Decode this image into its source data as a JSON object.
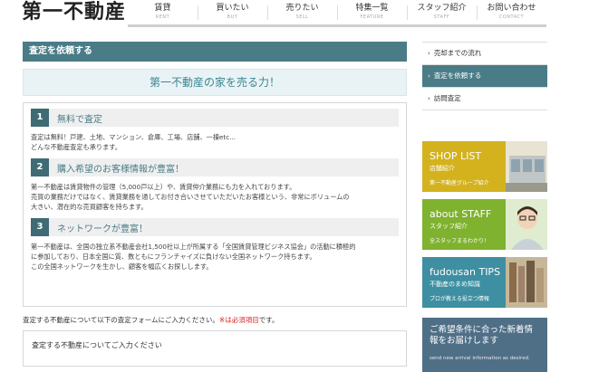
{
  "header": {
    "logo": "第一不動産",
    "nav": [
      {
        "jp": "賃貸",
        "en": "RENT"
      },
      {
        "jp": "買いたい",
        "en": "BUY"
      },
      {
        "jp": "売りたい",
        "en": "SELL"
      },
      {
        "jp": "特集一覧",
        "en": "FEATURE"
      },
      {
        "jp": "スタッフ紹介",
        "en": "STAFF"
      },
      {
        "jp": "お問い合わせ",
        "en": "CONTACT"
      }
    ]
  },
  "main": {
    "title": "査定を依頼する",
    "hero": "第一不動産の家を売る力！",
    "sections": [
      {
        "num": "1",
        "title": "無料で査定",
        "body": "査定は無料！戸建、土地、マンション、倉庫、工場、店舗、一棟etc...\nどんな不動産査定も承ります。"
      },
      {
        "num": "2",
        "title": "購入希望のお客様情報が豊富！",
        "body": "第一不動産は賃貸物件の管理（5,000戸以上）や、賃貸仲介業務にも力を入れております。\n売買の業務だけではなく、賃貸業務を通してお付き合いさせていただいたお客様という、非常にボリュームの\n大きい、潜在的な売買顧客を持ちます。"
      },
      {
        "num": "3",
        "title": "ネットワークが豊富！",
        "body": "第一不動産は、全国の独立系不動産会社1,500社以上が所属する「全国賃貸管理ビジネス協会」の活動に積極的\nに参加しており、日本全国に質、数ともにフランチャイズに負けない全国ネットワーク持ちます。\nこの全国ネットワークを生かし、顧客を幅広くお探しします。"
      }
    ],
    "note": "査定する不動産について以下の査定フォームにご入力ください。",
    "note_required": "※は必須項目",
    "note_end": "です。",
    "form_label": "査定する不動産についてご入力ください"
  },
  "sidebar": {
    "items": [
      {
        "label": "売却までの流れ",
        "active": false
      },
      {
        "label": "査定を依頼する",
        "active": true
      },
      {
        "label": "訪問査定",
        "active": false
      }
    ],
    "chevron": "›",
    "banners": [
      {
        "title": "SHOP LIST",
        "sub": "店舗紹介",
        "line": "第一不動産グループ紹介",
        "color": "#d3b21e"
      },
      {
        "title": "about STAFF",
        "sub": "スタッフ紹介",
        "line": "全スタッフまるわかり！",
        "color": "#7fb22e"
      },
      {
        "title": "fudousan TIPS",
        "sub": "不動産のまめ知識",
        "line": "プロが教える役立つ情報",
        "color": "#3d8fa1"
      },
      {
        "title": "ご希望条件に合った新着情報をお届けします",
        "line": "send new arrival information as desired.",
        "color": "#4f6f87"
      }
    ]
  }
}
